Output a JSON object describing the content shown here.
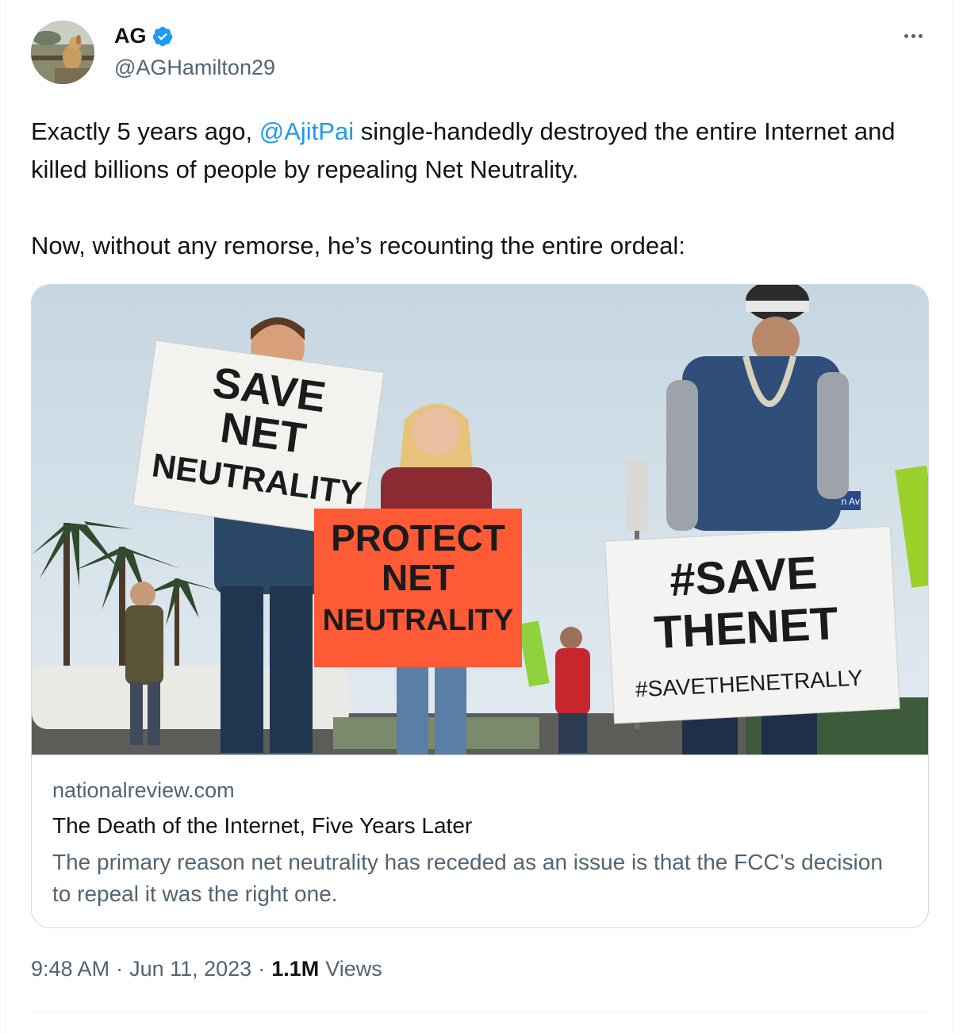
{
  "author": {
    "display_name": "AG",
    "handle": "@AGHamilton29",
    "verified": true,
    "avatar_icon": "dog-photo-avatar"
  },
  "more_icon": "ellipsis-icon",
  "tweet": {
    "line1_pre": "Exactly 5 years ago, ",
    "mention": "@AjitPai",
    "line1_post": " single-handedly destroyed the entire Internet and killed billions of people by repealing Net Neutrality.",
    "line2": "Now, without any remorse, he’s recounting the entire ordeal:"
  },
  "card": {
    "image": {
      "sign_left": [
        "SAVE",
        "NET",
        "NEUTRALITY"
      ],
      "sign_center": [
        "PROTECT",
        "NET",
        "NEUTRALITY"
      ],
      "sign_right": [
        "#SAVE",
        "THENET",
        "#SAVETHENETRALLY"
      ],
      "street_sign": "Ocean Av"
    },
    "domain": "nationalreview.com",
    "title": "The Death of the Internet, Five Years Later",
    "description": "The primary reason net neutrality has receded as an issue is that the FCC’s decision to repeal it was the right one."
  },
  "meta": {
    "time": "9:48 AM",
    "separator": "·",
    "date": "Jun 11, 2023",
    "views_count": "1.1M",
    "views_label": "Views"
  },
  "colors": {
    "accent": "#1d9bf0",
    "text": "#0f1419",
    "secondary": "#536471",
    "border": "#cfd9de"
  }
}
